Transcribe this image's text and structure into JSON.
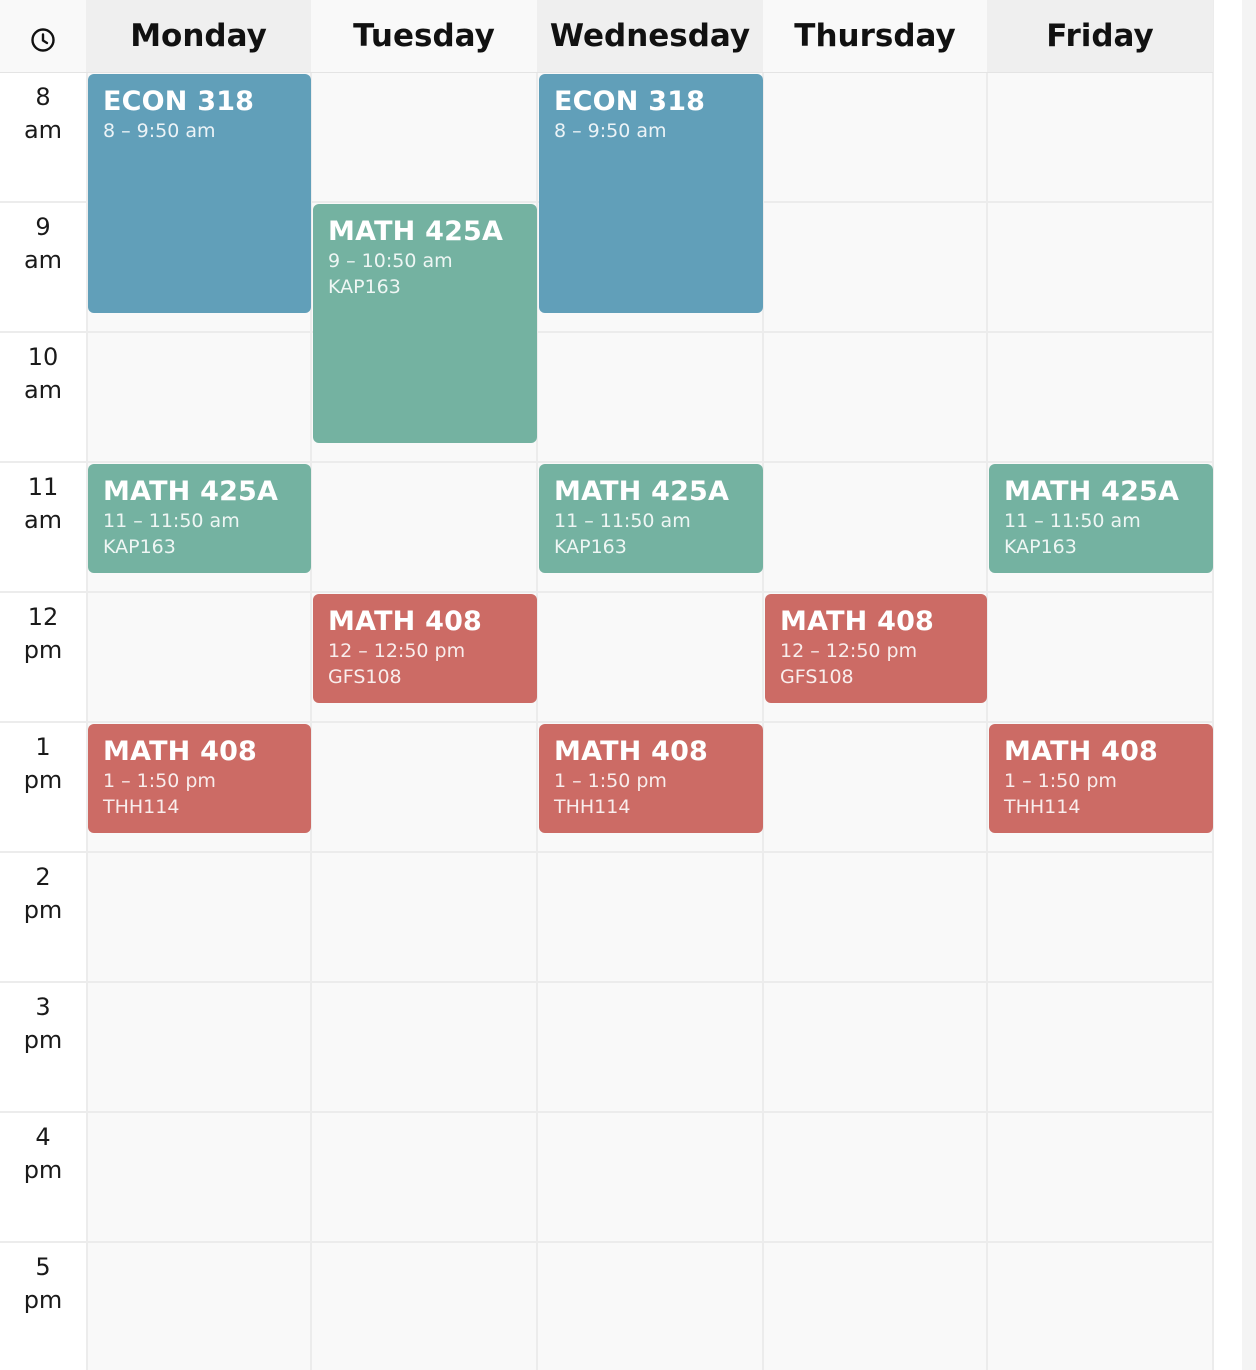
{
  "colors": {
    "econ": "#619fb9",
    "math425a": "#74b2a1",
    "math408": "#cc6b65"
  },
  "header": {
    "clock_icon": "clock-icon",
    "days": [
      "Monday",
      "Tuesday",
      "Wednesday",
      "Thursday",
      "Friday"
    ]
  },
  "times": [
    {
      "hour": "8",
      "period": "am"
    },
    {
      "hour": "9",
      "period": "am"
    },
    {
      "hour": "10",
      "period": "am"
    },
    {
      "hour": "11",
      "period": "am"
    },
    {
      "hour": "12",
      "period": "pm"
    },
    {
      "hour": "1",
      "period": "pm"
    },
    {
      "hour": "2",
      "period": "pm"
    },
    {
      "hour": "3",
      "period": "pm"
    },
    {
      "hour": "4",
      "period": "pm"
    },
    {
      "hour": "5",
      "period": "pm"
    }
  ],
  "events": [
    {
      "day": 0,
      "start": 8,
      "end": 9.833,
      "course": "ECON 318",
      "time": "8 – 9:50 am",
      "room": "",
      "color": "econ"
    },
    {
      "day": 2,
      "start": 8,
      "end": 9.833,
      "course": "ECON 318",
      "time": "8 – 9:50 am",
      "room": "",
      "color": "econ"
    },
    {
      "day": 1,
      "start": 9,
      "end": 10.833,
      "course": "MATH 425A",
      "time": "9 – 10:50 am",
      "room": "KAP163",
      "color": "math425a"
    },
    {
      "day": 0,
      "start": 11,
      "end": 11.833,
      "course": "MATH 425A",
      "time": "11 – 11:50 am",
      "room": "KAP163",
      "color": "math425a"
    },
    {
      "day": 2,
      "start": 11,
      "end": 11.833,
      "course": "MATH 425A",
      "time": "11 – 11:50 am",
      "room": "KAP163",
      "color": "math425a"
    },
    {
      "day": 4,
      "start": 11,
      "end": 11.833,
      "course": "MATH 425A",
      "time": "11 – 11:50 am",
      "room": "KAP163",
      "color": "math425a"
    },
    {
      "day": 1,
      "start": 12,
      "end": 12.833,
      "course": "MATH 408",
      "time": "12 – 12:50 pm",
      "room": "GFS108",
      "color": "math408"
    },
    {
      "day": 3,
      "start": 12,
      "end": 12.833,
      "course": "MATH 408",
      "time": "12 – 12:50 pm",
      "room": "GFS108",
      "color": "math408"
    },
    {
      "day": 0,
      "start": 13,
      "end": 13.833,
      "course": "MATH 408",
      "time": "1 – 1:50 pm",
      "room": "THH114",
      "color": "math408"
    },
    {
      "day": 2,
      "start": 13,
      "end": 13.833,
      "course": "MATH 408",
      "time": "1 – 1:50 pm",
      "room": "THH114",
      "color": "math408"
    },
    {
      "day": 4,
      "start": 13,
      "end": 13.833,
      "course": "MATH 408",
      "time": "1 – 1:50 pm",
      "room": "THH114",
      "color": "math408"
    }
  ]
}
